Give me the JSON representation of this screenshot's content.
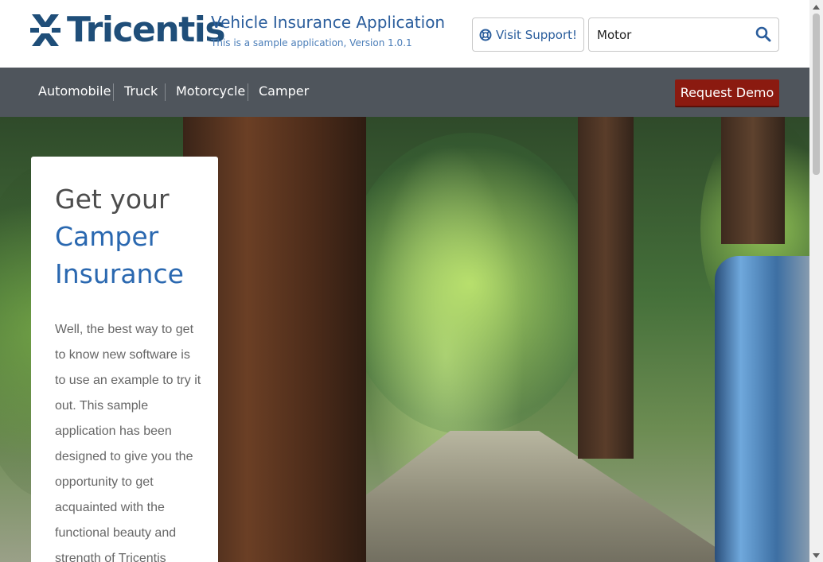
{
  "header": {
    "brand": "Tricentis",
    "app_title": "Vehicle Insurance Application",
    "app_subtitle": "This is a sample application, Version 1.0.1",
    "support_label": "Visit Support!",
    "search_value": "Motor",
    "brand_color": "#1f4e79",
    "accent_color": "#2a5d9c"
  },
  "nav": {
    "items": [
      {
        "label": "Automobile"
      },
      {
        "label": "Truck"
      },
      {
        "label": "Motorcycle"
      },
      {
        "label": "Camper"
      }
    ],
    "demo_label": "Request Demo",
    "bar_color": "#4f555c",
    "demo_color": "#8b1a10"
  },
  "hero": {
    "heading_line1": "Get your",
    "heading_line2": "Camper",
    "heading_line3": "Insurance",
    "body": "Well, the best way to get to know new software is to use an example to try it out. This sample application has been designed to give you the opportunity to get acquainted with the functional beauty and strength of Tricentis"
  },
  "icons": {
    "logo": "tricentis-logo-icon",
    "support": "lifebuoy-icon",
    "search": "search-icon"
  }
}
